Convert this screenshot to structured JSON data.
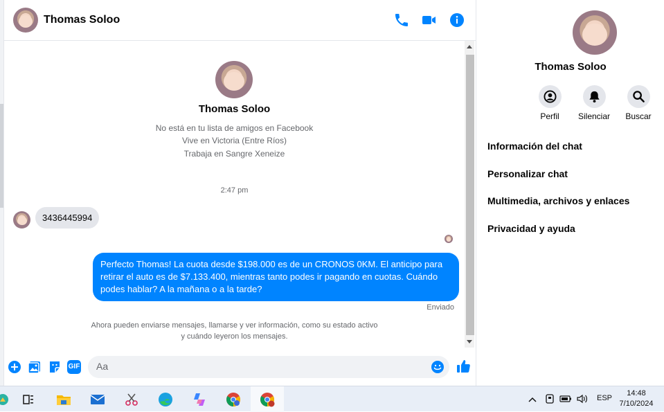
{
  "header": {
    "name": "Thomas Soloo",
    "icons": [
      "phone-icon",
      "video-icon",
      "info-icon"
    ],
    "accent": "#0084ff"
  },
  "profile": {
    "name": "Thomas Soloo",
    "lines": [
      "No está en tu lista de amigos en Facebook",
      "Vive en Victoria (Entre Ríos)",
      "Trabaja en Sangre Xeneize"
    ]
  },
  "conversation": {
    "timestamp": "2:47 pm",
    "incoming": "3436445994",
    "outgoing": "Perfecto Thomas!  La cuota desde $198.000 es de un CRONOS 0KM. El anticipo para retirar el auto es de $7.133.400, mientras tanto podes ir pagando en cuotas. Cuándo podes hablar? A la mañana o a la tarde?",
    "status": "Enviado",
    "info_line_1": "Ahora pueden enviarse mensajes, llamarse y ver información, como su estado activo",
    "info_line_2": "y cuándo leyeron los mensajes."
  },
  "composer": {
    "placeholder": "Aa",
    "value": "",
    "icons": [
      "plus-icon",
      "image-icon",
      "sticker-icon",
      "gif-icon",
      "emoji-icon",
      "like-icon"
    ],
    "gif_label": "GIF"
  },
  "side_panel": {
    "name": "Thomas Soloo",
    "actions": [
      {
        "label": "Perfil",
        "icon": "profile-icon"
      },
      {
        "label": "Silenciar",
        "icon": "bell-icon"
      },
      {
        "label": "Buscar",
        "icon": "search-icon"
      }
    ],
    "items": [
      "Información del chat",
      "Personalizar chat",
      "Multimedia, archivos y enlaces",
      "Privacidad y ayuda"
    ]
  },
  "taskbar": {
    "apps": [
      "task-view-icon",
      "file-explorer-icon",
      "mail-icon",
      "snipping-tool-icon",
      "edge-icon",
      "copilot-icon",
      "chrome-profile-icon",
      "chrome-icon"
    ],
    "language": "ESP",
    "time": "14:48",
    "date": "7/10/2024"
  }
}
